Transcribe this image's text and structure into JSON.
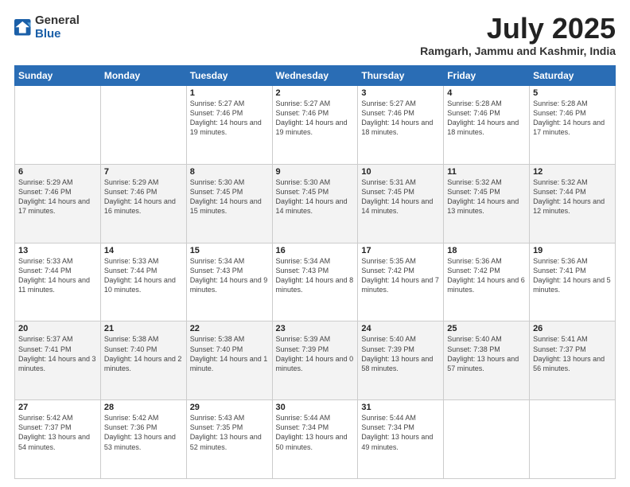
{
  "logo": {
    "general": "General",
    "blue": "Blue"
  },
  "header": {
    "month": "July 2025",
    "location": "Ramgarh, Jammu and Kashmir, India"
  },
  "weekdays": [
    "Sunday",
    "Monday",
    "Tuesday",
    "Wednesday",
    "Thursday",
    "Friday",
    "Saturday"
  ],
  "weeks": [
    [
      {
        "day": "",
        "info": ""
      },
      {
        "day": "",
        "info": ""
      },
      {
        "day": "1",
        "info": "Sunrise: 5:27 AM\nSunset: 7:46 PM\nDaylight: 14 hours and 19 minutes."
      },
      {
        "day": "2",
        "info": "Sunrise: 5:27 AM\nSunset: 7:46 PM\nDaylight: 14 hours and 19 minutes."
      },
      {
        "day": "3",
        "info": "Sunrise: 5:27 AM\nSunset: 7:46 PM\nDaylight: 14 hours and 18 minutes."
      },
      {
        "day": "4",
        "info": "Sunrise: 5:28 AM\nSunset: 7:46 PM\nDaylight: 14 hours and 18 minutes."
      },
      {
        "day": "5",
        "info": "Sunrise: 5:28 AM\nSunset: 7:46 PM\nDaylight: 14 hours and 17 minutes."
      }
    ],
    [
      {
        "day": "6",
        "info": "Sunrise: 5:29 AM\nSunset: 7:46 PM\nDaylight: 14 hours and 17 minutes."
      },
      {
        "day": "7",
        "info": "Sunrise: 5:29 AM\nSunset: 7:46 PM\nDaylight: 14 hours and 16 minutes."
      },
      {
        "day": "8",
        "info": "Sunrise: 5:30 AM\nSunset: 7:45 PM\nDaylight: 14 hours and 15 minutes."
      },
      {
        "day": "9",
        "info": "Sunrise: 5:30 AM\nSunset: 7:45 PM\nDaylight: 14 hours and 14 minutes."
      },
      {
        "day": "10",
        "info": "Sunrise: 5:31 AM\nSunset: 7:45 PM\nDaylight: 14 hours and 14 minutes."
      },
      {
        "day": "11",
        "info": "Sunrise: 5:32 AM\nSunset: 7:45 PM\nDaylight: 14 hours and 13 minutes."
      },
      {
        "day": "12",
        "info": "Sunrise: 5:32 AM\nSunset: 7:44 PM\nDaylight: 14 hours and 12 minutes."
      }
    ],
    [
      {
        "day": "13",
        "info": "Sunrise: 5:33 AM\nSunset: 7:44 PM\nDaylight: 14 hours and 11 minutes."
      },
      {
        "day": "14",
        "info": "Sunrise: 5:33 AM\nSunset: 7:44 PM\nDaylight: 14 hours and 10 minutes."
      },
      {
        "day": "15",
        "info": "Sunrise: 5:34 AM\nSunset: 7:43 PM\nDaylight: 14 hours and 9 minutes."
      },
      {
        "day": "16",
        "info": "Sunrise: 5:34 AM\nSunset: 7:43 PM\nDaylight: 14 hours and 8 minutes."
      },
      {
        "day": "17",
        "info": "Sunrise: 5:35 AM\nSunset: 7:42 PM\nDaylight: 14 hours and 7 minutes."
      },
      {
        "day": "18",
        "info": "Sunrise: 5:36 AM\nSunset: 7:42 PM\nDaylight: 14 hours and 6 minutes."
      },
      {
        "day": "19",
        "info": "Sunrise: 5:36 AM\nSunset: 7:41 PM\nDaylight: 14 hours and 5 minutes."
      }
    ],
    [
      {
        "day": "20",
        "info": "Sunrise: 5:37 AM\nSunset: 7:41 PM\nDaylight: 14 hours and 3 minutes."
      },
      {
        "day": "21",
        "info": "Sunrise: 5:38 AM\nSunset: 7:40 PM\nDaylight: 14 hours and 2 minutes."
      },
      {
        "day": "22",
        "info": "Sunrise: 5:38 AM\nSunset: 7:40 PM\nDaylight: 14 hours and 1 minute."
      },
      {
        "day": "23",
        "info": "Sunrise: 5:39 AM\nSunset: 7:39 PM\nDaylight: 14 hours and 0 minutes."
      },
      {
        "day": "24",
        "info": "Sunrise: 5:40 AM\nSunset: 7:39 PM\nDaylight: 13 hours and 58 minutes."
      },
      {
        "day": "25",
        "info": "Sunrise: 5:40 AM\nSunset: 7:38 PM\nDaylight: 13 hours and 57 minutes."
      },
      {
        "day": "26",
        "info": "Sunrise: 5:41 AM\nSunset: 7:37 PM\nDaylight: 13 hours and 56 minutes."
      }
    ],
    [
      {
        "day": "27",
        "info": "Sunrise: 5:42 AM\nSunset: 7:37 PM\nDaylight: 13 hours and 54 minutes."
      },
      {
        "day": "28",
        "info": "Sunrise: 5:42 AM\nSunset: 7:36 PM\nDaylight: 13 hours and 53 minutes."
      },
      {
        "day": "29",
        "info": "Sunrise: 5:43 AM\nSunset: 7:35 PM\nDaylight: 13 hours and 52 minutes."
      },
      {
        "day": "30",
        "info": "Sunrise: 5:44 AM\nSunset: 7:34 PM\nDaylight: 13 hours and 50 minutes."
      },
      {
        "day": "31",
        "info": "Sunrise: 5:44 AM\nSunset: 7:34 PM\nDaylight: 13 hours and 49 minutes."
      },
      {
        "day": "",
        "info": ""
      },
      {
        "day": "",
        "info": ""
      }
    ]
  ]
}
